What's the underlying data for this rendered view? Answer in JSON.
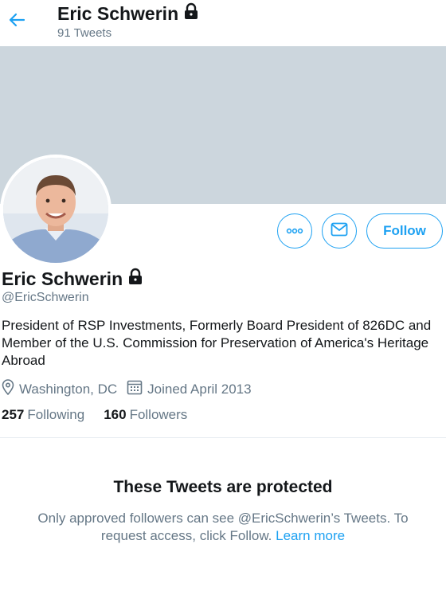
{
  "header": {
    "name": "Eric Schwerin",
    "tweet_count": "91 Tweets"
  },
  "profile": {
    "name": "Eric Schwerin",
    "handle": "@EricSchwerin",
    "bio": "President of RSP Investments, Formerly Board President of 826DC and Member of the U.S. Commission for Preservation of America's Heritage Abroad",
    "location": "Washington, DC",
    "joined": "Joined April 2013",
    "following_count": "257",
    "following_label": "Following",
    "followers_count": "160",
    "followers_label": "Followers"
  },
  "actions": {
    "follow_label": "Follow"
  },
  "protected": {
    "title": "These Tweets are protected",
    "text": "Only approved followers can see @EricSchwerin’s Tweets. To request access, click Follow.",
    "link": "Learn more"
  },
  "colors": {
    "accent": "#1da1f2",
    "banner": "#ccd6dd",
    "secondary_text": "#657786"
  }
}
